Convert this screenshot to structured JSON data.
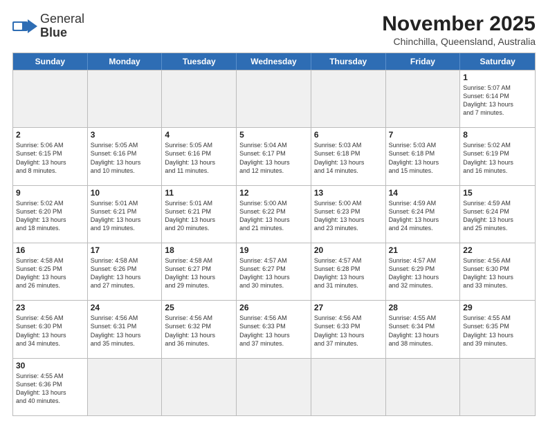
{
  "header": {
    "logo_general": "General",
    "logo_blue": "Blue",
    "month": "November 2025",
    "location": "Chinchilla, Queensland, Australia"
  },
  "days_of_week": [
    "Sunday",
    "Monday",
    "Tuesday",
    "Wednesday",
    "Thursday",
    "Friday",
    "Saturday"
  ],
  "weeks": [
    [
      {
        "day": "",
        "info": "",
        "empty": true
      },
      {
        "day": "",
        "info": "",
        "empty": true
      },
      {
        "day": "",
        "info": "",
        "empty": true
      },
      {
        "day": "",
        "info": "",
        "empty": true
      },
      {
        "day": "",
        "info": "",
        "empty": true
      },
      {
        "day": "",
        "info": "",
        "empty": true
      },
      {
        "day": "1",
        "info": "Sunrise: 5:07 AM\nSunset: 6:14 PM\nDaylight: 13 hours\nand 7 minutes."
      }
    ],
    [
      {
        "day": "2",
        "info": "Sunrise: 5:06 AM\nSunset: 6:15 PM\nDaylight: 13 hours\nand 8 minutes."
      },
      {
        "day": "3",
        "info": "Sunrise: 5:05 AM\nSunset: 6:16 PM\nDaylight: 13 hours\nand 10 minutes."
      },
      {
        "day": "4",
        "info": "Sunrise: 5:05 AM\nSunset: 6:16 PM\nDaylight: 13 hours\nand 11 minutes."
      },
      {
        "day": "5",
        "info": "Sunrise: 5:04 AM\nSunset: 6:17 PM\nDaylight: 13 hours\nand 12 minutes."
      },
      {
        "day": "6",
        "info": "Sunrise: 5:03 AM\nSunset: 6:18 PM\nDaylight: 13 hours\nand 14 minutes."
      },
      {
        "day": "7",
        "info": "Sunrise: 5:03 AM\nSunset: 6:18 PM\nDaylight: 13 hours\nand 15 minutes."
      },
      {
        "day": "8",
        "info": "Sunrise: 5:02 AM\nSunset: 6:19 PM\nDaylight: 13 hours\nand 16 minutes."
      }
    ],
    [
      {
        "day": "9",
        "info": "Sunrise: 5:02 AM\nSunset: 6:20 PM\nDaylight: 13 hours\nand 18 minutes."
      },
      {
        "day": "10",
        "info": "Sunrise: 5:01 AM\nSunset: 6:21 PM\nDaylight: 13 hours\nand 19 minutes."
      },
      {
        "day": "11",
        "info": "Sunrise: 5:01 AM\nSunset: 6:21 PM\nDaylight: 13 hours\nand 20 minutes."
      },
      {
        "day": "12",
        "info": "Sunrise: 5:00 AM\nSunset: 6:22 PM\nDaylight: 13 hours\nand 21 minutes."
      },
      {
        "day": "13",
        "info": "Sunrise: 5:00 AM\nSunset: 6:23 PM\nDaylight: 13 hours\nand 23 minutes."
      },
      {
        "day": "14",
        "info": "Sunrise: 4:59 AM\nSunset: 6:24 PM\nDaylight: 13 hours\nand 24 minutes."
      },
      {
        "day": "15",
        "info": "Sunrise: 4:59 AM\nSunset: 6:24 PM\nDaylight: 13 hours\nand 25 minutes."
      }
    ],
    [
      {
        "day": "16",
        "info": "Sunrise: 4:58 AM\nSunset: 6:25 PM\nDaylight: 13 hours\nand 26 minutes."
      },
      {
        "day": "17",
        "info": "Sunrise: 4:58 AM\nSunset: 6:26 PM\nDaylight: 13 hours\nand 27 minutes."
      },
      {
        "day": "18",
        "info": "Sunrise: 4:58 AM\nSunset: 6:27 PM\nDaylight: 13 hours\nand 29 minutes."
      },
      {
        "day": "19",
        "info": "Sunrise: 4:57 AM\nSunset: 6:27 PM\nDaylight: 13 hours\nand 30 minutes."
      },
      {
        "day": "20",
        "info": "Sunrise: 4:57 AM\nSunset: 6:28 PM\nDaylight: 13 hours\nand 31 minutes."
      },
      {
        "day": "21",
        "info": "Sunrise: 4:57 AM\nSunset: 6:29 PM\nDaylight: 13 hours\nand 32 minutes."
      },
      {
        "day": "22",
        "info": "Sunrise: 4:56 AM\nSunset: 6:30 PM\nDaylight: 13 hours\nand 33 minutes."
      }
    ],
    [
      {
        "day": "23",
        "info": "Sunrise: 4:56 AM\nSunset: 6:30 PM\nDaylight: 13 hours\nand 34 minutes."
      },
      {
        "day": "24",
        "info": "Sunrise: 4:56 AM\nSunset: 6:31 PM\nDaylight: 13 hours\nand 35 minutes."
      },
      {
        "day": "25",
        "info": "Sunrise: 4:56 AM\nSunset: 6:32 PM\nDaylight: 13 hours\nand 36 minutes."
      },
      {
        "day": "26",
        "info": "Sunrise: 4:56 AM\nSunset: 6:33 PM\nDaylight: 13 hours\nand 37 minutes."
      },
      {
        "day": "27",
        "info": "Sunrise: 4:56 AM\nSunset: 6:33 PM\nDaylight: 13 hours\nand 37 minutes."
      },
      {
        "day": "28",
        "info": "Sunrise: 4:55 AM\nSunset: 6:34 PM\nDaylight: 13 hours\nand 38 minutes."
      },
      {
        "day": "29",
        "info": "Sunrise: 4:55 AM\nSunset: 6:35 PM\nDaylight: 13 hours\nand 39 minutes."
      }
    ],
    [
      {
        "day": "30",
        "info": "Sunrise: 4:55 AM\nSunset: 6:36 PM\nDaylight: 13 hours\nand 40 minutes."
      },
      {
        "day": "",
        "info": "",
        "empty": true
      },
      {
        "day": "",
        "info": "",
        "empty": true
      },
      {
        "day": "",
        "info": "",
        "empty": true
      },
      {
        "day": "",
        "info": "",
        "empty": true
      },
      {
        "day": "",
        "info": "",
        "empty": true
      },
      {
        "day": "",
        "info": "",
        "empty": true
      }
    ]
  ]
}
